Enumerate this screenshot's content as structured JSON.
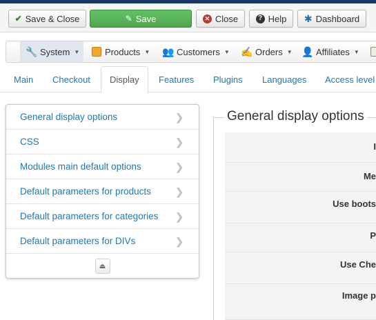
{
  "toolbar": {
    "save_close_label": "Save & Close",
    "save_label": "Save",
    "close_label": "Close",
    "help_label": "Help",
    "dashboard_label": "Dashboard"
  },
  "menubar": {
    "items": [
      {
        "label": "System",
        "icon": "wrench-icon"
      },
      {
        "label": "Products",
        "icon": "box-icon"
      },
      {
        "label": "Customers",
        "icon": "users-icon"
      },
      {
        "label": "Orders",
        "icon": "orders-icon"
      },
      {
        "label": "Affiliates",
        "icon": "affiliates-icon"
      }
    ]
  },
  "tabs": [
    {
      "label": "Main"
    },
    {
      "label": "Checkout"
    },
    {
      "label": "Display",
      "active": true
    },
    {
      "label": "Features"
    },
    {
      "label": "Plugins"
    },
    {
      "label": "Languages"
    },
    {
      "label": "Access level"
    }
  ],
  "sidenav": {
    "items": [
      {
        "label": "General display options"
      },
      {
        "label": "CSS"
      },
      {
        "label": "Modules main default options"
      },
      {
        "label": "Default parameters for products"
      },
      {
        "label": "Default parameters for categories"
      },
      {
        "label": "Default parameters for DIVs"
      }
    ]
  },
  "section": {
    "title": "General display options",
    "rows": [
      {
        "label": "I"
      },
      {
        "label": "Me"
      },
      {
        "label": "Use boots"
      },
      {
        "label": "P"
      },
      {
        "label": "Use Che"
      },
      {
        "label": "Image p"
      }
    ]
  },
  "colors": {
    "link": "#1a7ab8",
    "save_green": "#51a351",
    "close_red": "#bd362f",
    "top_bar": "#1a3867"
  }
}
